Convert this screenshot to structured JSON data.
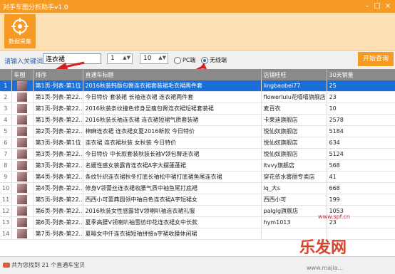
{
  "window": {
    "title": "对手车图分析助手v1.0"
  },
  "ribbon": {
    "button_label": "数据采集"
  },
  "search": {
    "keyword_label": "请输入关键词：",
    "keyword_value": "连衣裙",
    "page_from": "1",
    "page_to": "10",
    "radio_pc": "PC端",
    "radio_wireless": "无线端",
    "query_button": "开始查询"
  },
  "table": {
    "headers": [
      "车图",
      "排序",
      "直通车标题",
      "店铺旺旺",
      "30天销量"
    ],
    "rows": [
      {
        "n": "1",
        "rank": "第1页-列表-第1位",
        "title": "2016秋装韩版包臀连衣裙套装裙毛衣裙两件套",
        "shop": "lingbaobei77",
        "sales": "25"
      },
      {
        "n": "2",
        "rank": "第1页-列表-第22...",
        "title": "今日特价 套装裙 长袖连衣裙 连衣裙两件套",
        "shop": "flowerlulu花嘻嘻旗舰店",
        "sales": "23"
      },
      {
        "n": "3",
        "rank": "第1页-列表-第22...",
        "title": "2016秋装条纹撞色修身显瘦包臀连衣裙短裙套装裙",
        "shop": "麦百衣",
        "sales": "10"
      },
      {
        "n": "4",
        "rank": "第1页-列表-第22...",
        "title": "2016秋装长袖连衣裙 连衣裙短裙气质套装裙",
        "shop": "卡莱迪旗舰店",
        "sales": "2578"
      },
      {
        "n": "5",
        "rank": "第2页-列表-第22...",
        "title": "棉麻连衣裙 连衣裙女夏2016新款 今日特价",
        "shop": "悦仙奴旗舰店",
        "sales": "5184"
      },
      {
        "n": "6",
        "rank": "第3页-列表-第1位",
        "title": "连衣裙 连衣裙秋装 女秋装 今日特价",
        "shop": "悦仙奴旗舰店",
        "sales": "634"
      },
      {
        "n": "7",
        "rank": "第3页-列表-第22...",
        "title": "今日特价 中长款套装秋装长袖V领包臀连衣裙",
        "shop": "悦仙奴旗舰店",
        "sales": "5124"
      },
      {
        "n": "8",
        "rank": "第3页-列表-第22...",
        "title": "名媛性感女装露背连衣裙A字大摆蓬蓬裙",
        "shop": "ltvvy旗舰店",
        "sales": "568"
      },
      {
        "n": "9",
        "rank": "第4页-列表-第22...",
        "title": "条纹针织连衣裙秋冬打底长袖松中裙打底裙鱼尾连衣裙",
        "shop": "穿花依水雾丽专卖店",
        "sales": "41"
      },
      {
        "n": "10",
        "rank": "第4页-列表-第22...",
        "title": "修身V领蕾丝连衣裙收腰气质中袖鱼尾打底裙",
        "shop": "lq_大s",
        "sales": "668"
      },
      {
        "n": "11",
        "rank": "第5页-列表-第22...",
        "title": "西西小可蕾典圆领中袖白色连衣裙A字短裙女",
        "shop": "西西小可",
        "sales": "199"
      },
      {
        "n": "12",
        "rank": "第6页-列表-第22...",
        "title": "2016秋装女性感露背V领喇叭袖连衣裙礼服",
        "shop": "palglg旗舰店",
        "sales": "1053"
      },
      {
        "n": "13",
        "rank": "第6页-列表-第22...",
        "title": "夏季高腰V领喇叭袖雪纺印花连衣裙女中长款",
        "shop": "hym1013",
        "sales": "23"
      },
      {
        "n": "14",
        "rank": "第7页-列表-第22...",
        "title": "夏喻女中仟连衣裙短袖拼接a字裙收腰休闲裙",
        "shop": "",
        "sales": ""
      }
    ]
  },
  "status": {
    "text": "共为您找到 21 个直通车宝贝"
  },
  "watermark": {
    "brand": "乐发网",
    "url": "www.spf.cn",
    "url2": "www.majia..."
  },
  "colors": {
    "accent": "#f79a24",
    "selection": "#1a6fd6",
    "arrow": "#d42020"
  }
}
